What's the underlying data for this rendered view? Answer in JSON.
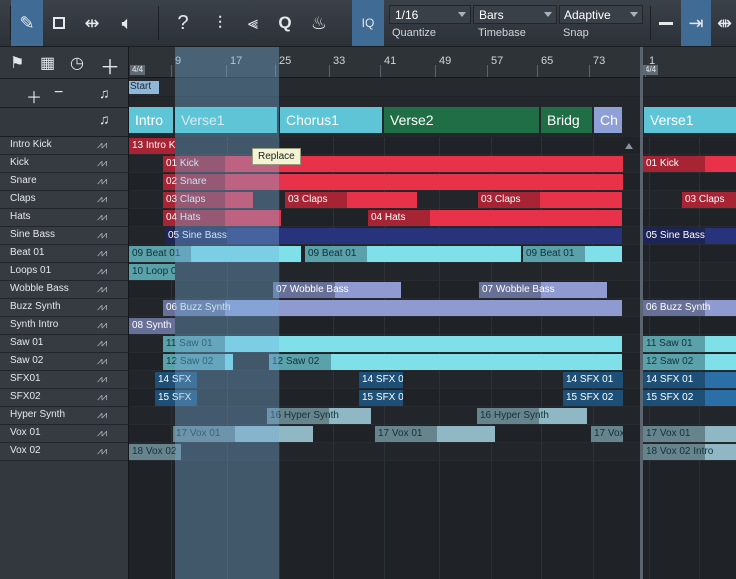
{
  "toolbar": {
    "quantize": {
      "value": "1/16",
      "label": "Quantize"
    },
    "timebase": {
      "value": "Bars",
      "label": "Timebase"
    },
    "snap": {
      "value": "Adaptive",
      "label": "Snap"
    },
    "iq_label": "IQ",
    "help_label": "?",
    "q_label": "Q"
  },
  "ruler": {
    "numbers": [
      "9",
      "17",
      "25",
      "33",
      "41",
      "49",
      "57",
      "65",
      "73",
      "1"
    ],
    "sig_left": "4/4",
    "sig_right": "4/4"
  },
  "marker": {
    "start_label": "Start"
  },
  "arranger": {
    "sections": [
      "Intro",
      "Verse1",
      "Chorus1",
      "Verse2",
      "Bridg",
      "Ch",
      "Verse1"
    ]
  },
  "tooltip": "Replace",
  "tracks": [
    "Intro Kick",
    "Kick",
    "Snare",
    "Claps",
    "Hats",
    "Sine Bass",
    "Beat 01",
    "Loops 01",
    "Wobble Bass",
    "Buzz Synth",
    "Synth Intro",
    "Saw 01",
    "Saw 02",
    "SFX01",
    "SFX02",
    "Hyper Synth",
    "Vox 01",
    "Vox 02"
  ],
  "clips": {
    "c0": "13 Intro K",
    "c1": "01 Kick",
    "c2": "01 Kick",
    "c3": "02 Snare",
    "c4": "03 Claps",
    "c5": "03 Claps",
    "c6": "03 Claps",
    "c7": "03 Claps",
    "c8": "04 Hats",
    "c9": "04 Hats",
    "c10": "05 Sine Bass",
    "c11": "05 Sine Bass",
    "c12": "09 Beat 01",
    "c13": "09 Beat 01",
    "c14": "09 Beat 01",
    "c15": "10 Loop 0",
    "c16": "07 Wobble Bass",
    "c17": "07 Wobble Bass",
    "c18": "06 Buzz Synth",
    "c19": "06 Buzz Synth",
    "c20": "08 Synth",
    "c21": "11 Saw 01",
    "c22": "11 Saw 01",
    "c23": "12 Saw 02",
    "c24": "12 Saw 02",
    "c25": "12 Saw 02",
    "c26": "14 SFX",
    "c27": "14 SFX 0",
    "c28": "14 SFX 01",
    "c29": "14 SFX 01",
    "c30": "15 SFX",
    "c31": "15 SFX 0",
    "c32": "15 SFX 02",
    "c33": "15 SFX 02",
    "c34": "16 Hyper Synth",
    "c35": "16 Hyper Synth",
    "c36": "17 Vox 01",
    "c37": "17 Vox 01",
    "c38": "17 Vox",
    "c39": "17 Vox 01",
    "c40": "18 Vox 02",
    "c41": "18 Vox 02 Intro"
  },
  "colors": {
    "red": "#e8324a",
    "navy": "#27337a",
    "cyan": "#7fe0ea",
    "lavender": "#8f9bd0",
    "steel": "#8fb7c4",
    "sfx_blue": "#2a6fa6",
    "section_cyan": "#5ec5d6",
    "section_green": "#1f6e45",
    "section_lav": "#8fa0d6"
  }
}
